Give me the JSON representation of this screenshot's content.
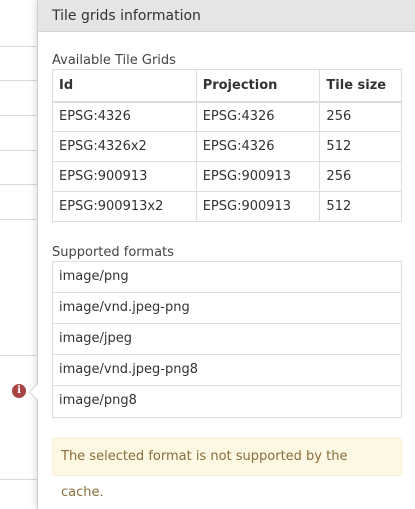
{
  "popover": {
    "title": "Tile grids information",
    "grids_section_title": "Available Tile Grids",
    "grids_table": {
      "headers": [
        "Id",
        "Projection",
        "Tile size"
      ],
      "rows": [
        [
          "EPSG:4326",
          "EPSG:4326",
          "256"
        ],
        [
          "EPSG:4326x2",
          "EPSG:4326",
          "512"
        ],
        [
          "EPSG:900913",
          "EPSG:900913",
          "256"
        ],
        [
          "EPSG:900913x2",
          "EPSG:900913",
          "512"
        ]
      ]
    },
    "formats_section_title": "Supported formats",
    "formats": [
      "image/png",
      "image/vnd.jpeg-png",
      "image/jpeg",
      "image/vnd.jpeg-png8",
      "image/png8"
    ],
    "warning": "The selected format is not supported by the cache."
  },
  "background": {
    "info_icon": "info-icon",
    "info_icon_glyph": "i",
    "info_icon_color": "#a94442"
  },
  "colors": {
    "header_bg": "#e5e5e5",
    "warning_bg": "#fcf8e3",
    "warning_text": "#8a6d3b",
    "border": "#dddddd"
  }
}
